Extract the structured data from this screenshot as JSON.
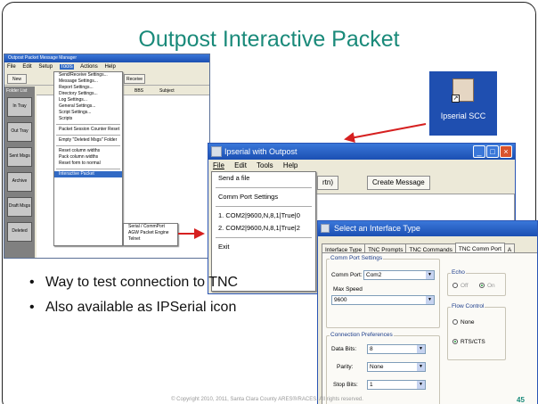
{
  "slide": {
    "title": "Outpost Interactive Packet",
    "bullets": [
      "Way to test connection to TNC",
      "Also available as IPSerial icon"
    ],
    "footer": "© Copyright 2010, 2011, Santa Clara County ARES®/RACES. All rights reserved.",
    "page_number": "45",
    "accent_color": "#1a8a7a",
    "arrow_color": "#d62020"
  },
  "outpost_window": {
    "title": "Outpost Packet Message Manager",
    "menu": [
      "File",
      "Edit",
      "Setup",
      "Tools",
      "Actions",
      "Help"
    ],
    "toolbar": [
      "New",
      "Receive"
    ],
    "sidebar_header": "Folder List",
    "sidebar_buttons": [
      "In Tray",
      "Out Tray",
      "Sent Msgs",
      "Archive",
      "Draft Msgs",
      "Deleted"
    ],
    "list_headers": [
      "BBS",
      "Subject"
    ],
    "tools_menu": [
      "Send/Receive Settings...",
      "Message Settings...",
      "Report Settings...",
      "Directory Settings...",
      "Log Settings...",
      "General Settings...",
      "Script Settings...",
      "Scripts",
      "Packet Session Counter Reset",
      "Empty \"Deleted Msgs\" Folder",
      "Reset column widths",
      "Pack column widths",
      "Reset form to normal",
      "Interactive Packet"
    ],
    "interactive_submenu": [
      "Serial / CommPort",
      "AGW Packet Engine",
      "Telnet"
    ]
  },
  "desktop_icon": {
    "label": "Ipserial SCC",
    "icon": "ipserial-app-icon"
  },
  "ipserial_window": {
    "title": "Ipserial with Outpost",
    "menu": [
      "File",
      "Edit",
      "Tools",
      "Help"
    ],
    "toolbar": [
      "rtn)",
      "Create Message"
    ],
    "file_menu": [
      "Send a file",
      "Comm Port Settings",
      "1. COM2|9600,N,8,1|True|0",
      "2. COM2|9600,N,8,1|True|2",
      "Exit"
    ]
  },
  "select_dialog": {
    "title": "Select an Interface Type",
    "tabs": [
      "Interface Type",
      "TNC Prompts",
      "TNC Commands",
      "TNC Comm Port",
      "A"
    ],
    "active_tab": "TNC Comm Port",
    "comm_port_group": "Comm Port Settings",
    "comm_port_label": "Comm Port:",
    "comm_port_value": "Com2",
    "max_speed_label": "Max Speed",
    "max_speed_value": "9600",
    "conn_pref_group": "Connection Preferences",
    "data_bits_label": "Data Bits:",
    "data_bits_value": "8",
    "parity_label": "Parity:",
    "parity_value": "None",
    "stop_bits_label": "Stop Bits:",
    "stop_bits_value": "1",
    "echo_group": "Echo",
    "echo_off": "Off",
    "echo_on": "On",
    "flow_group": "Flow Control",
    "flow_none": "None",
    "flow_rts": "RTS/CTS"
  }
}
